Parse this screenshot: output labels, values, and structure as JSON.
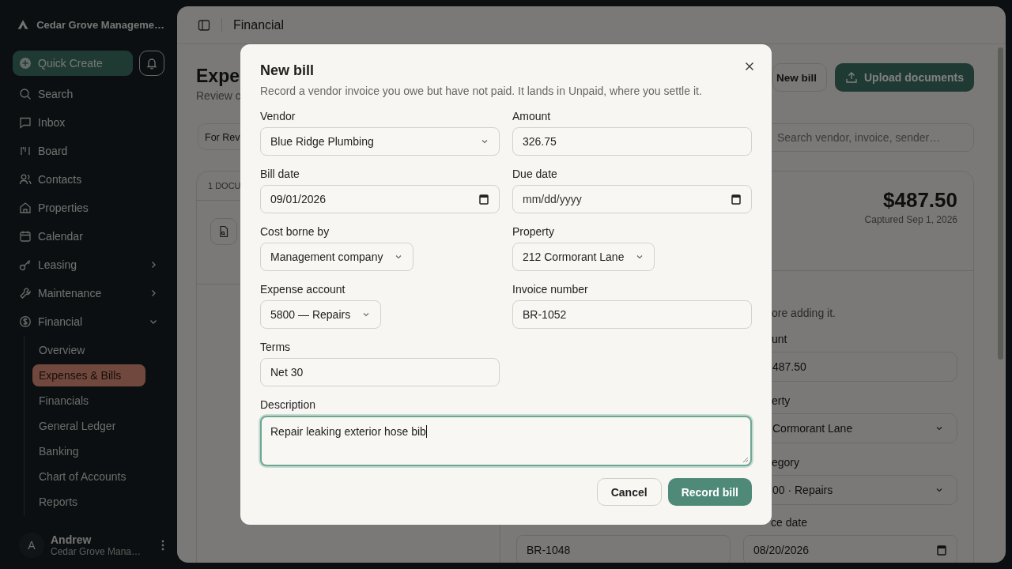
{
  "sidebar": {
    "brand": "Cedar Grove Manageme…",
    "quick_create": "Quick Create",
    "nav": [
      {
        "label": "Search"
      },
      {
        "label": "Inbox"
      },
      {
        "label": "Board"
      },
      {
        "label": "Contacts"
      },
      {
        "label": "Properties"
      },
      {
        "label": "Calendar"
      },
      {
        "label": "Leasing",
        "expanded": false
      },
      {
        "label": "Maintenance",
        "expanded": false
      },
      {
        "label": "Financial",
        "expanded": true,
        "children": [
          {
            "label": "Overview",
            "selected": false
          },
          {
            "label": "Expenses & Bills",
            "selected": true
          },
          {
            "label": "Financials",
            "selected": false
          },
          {
            "label": "General Ledger",
            "selected": false
          },
          {
            "label": "Banking",
            "selected": false
          },
          {
            "label": "Chart of Accounts",
            "selected": false
          },
          {
            "label": "Reports",
            "selected": false
          }
        ]
      }
    ],
    "user": {
      "initial": "A",
      "name": "Andrew",
      "org": "Cedar Grove Mana…"
    }
  },
  "header": {
    "title": "Financial"
  },
  "page": {
    "title": "Expe",
    "subtitle": "Review c",
    "buttons": [
      {
        "label": "New bill",
        "kind": "outline"
      },
      {
        "label": "Upload documents",
        "kind": "primary"
      }
    ],
    "filter": "For Rev",
    "search": {
      "placeholder": "Search vendor, invoice, sender…"
    },
    "list_header": "1 DOCU",
    "detail": {
      "amount": "$487.50",
      "captured": "Captured Sep 1, 2026",
      "note": "ore adding it.",
      "fields": [
        {
          "label": "unt",
          "value": "487.50",
          "kind": "text"
        },
        {
          "label": "erty",
          "value": "Cormorant Lane",
          "kind": "select"
        },
        {
          "label": "egory",
          "value": "00 · Repairs",
          "kind": "select"
        }
      ],
      "bottom_fields": [
        {
          "value": "BR-1048",
          "kind": "text"
        },
        {
          "label": "ce date",
          "value": "08/20/2026",
          "kind": "date"
        }
      ]
    }
  },
  "modal": {
    "title": "New bill",
    "description": "Record a vendor invoice you owe but have not paid. It lands in Unpaid, where you settle it.",
    "fields": [
      {
        "label": "Vendor",
        "value": "Blue Ridge Plumbing",
        "kind": "combobox",
        "focused": false
      },
      {
        "label": "Amount",
        "value": "326.75",
        "kind": "text",
        "focused": false
      },
      {
        "label": "Bill date",
        "value": "09/01/2026",
        "kind": "date",
        "focused": false
      },
      {
        "label": "Due date",
        "placeholder": "mm/dd/yyyy",
        "kind": "date",
        "focused": false
      },
      {
        "label": "Cost borne by",
        "value": "Management company",
        "kind": "select",
        "focused": false
      },
      {
        "label": "Property",
        "value": "212 Cormorant Lane",
        "kind": "select",
        "focused": false
      },
      {
        "label": "Expense account",
        "value": "5800 — Repairs",
        "kind": "select",
        "focused": false
      },
      {
        "label": "Invoice number",
        "value": "BR-1052",
        "kind": "text",
        "focused": false
      },
      {
        "label": "Terms",
        "value": "Net 30",
        "kind": "text",
        "focused": false
      },
      {
        "label": "Description",
        "value": "Repair leaking exterior hose bib",
        "kind": "textarea",
        "focused": true
      }
    ],
    "buttons": [
      {
        "label": "Cancel",
        "kind": "secondary"
      },
      {
        "label": "Record bill",
        "kind": "primary"
      }
    ]
  }
}
